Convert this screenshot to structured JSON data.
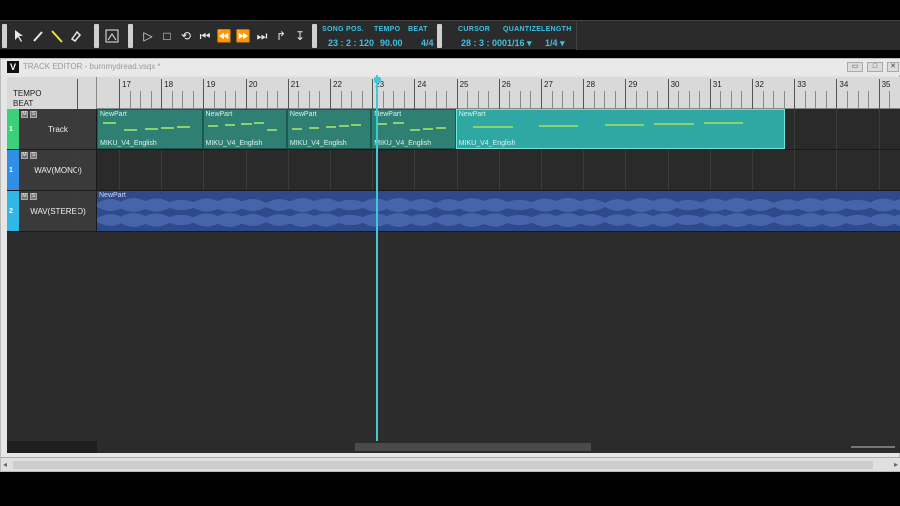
{
  "toolbar": {
    "tools": [
      {
        "name": "arrow-tool-icon"
      },
      {
        "name": "pencil-tool-icon"
      },
      {
        "name": "line-tool-icon",
        "active": true
      },
      {
        "name": "eraser-tool-icon"
      },
      {
        "name": "realtime-input-icon"
      }
    ],
    "transport": [
      {
        "name": "play-button",
        "glyph": "▷"
      },
      {
        "name": "stop-button",
        "glyph": "□"
      },
      {
        "name": "loop-button",
        "glyph": "⟲"
      },
      {
        "name": "go-to-start-button",
        "glyph": "⏮"
      },
      {
        "name": "rewind-button",
        "glyph": "⏪"
      },
      {
        "name": "fast-forward-button",
        "glyph": "⏩"
      },
      {
        "name": "go-to-end-button",
        "glyph": "⏭"
      },
      {
        "name": "auto-scroll-button",
        "glyph": "↱"
      },
      {
        "name": "punch-button",
        "glyph": "↧"
      }
    ],
    "song_pos_label": "SONG POS.",
    "song_pos_value": "23 : 2 : 120",
    "tempo_label": "TEMPO",
    "tempo_value": "90.00",
    "beat_label": "BEAT",
    "beat_value": "4/4",
    "cursor_label": "CURSOR",
    "cursor_value": "28 : 3 : 000",
    "quantize_label": "QUANTIZE",
    "quantize_value": "1/16 ▾",
    "length_label": "LENGTH",
    "length_value": "1/4 ▾"
  },
  "window": {
    "title": "TRACK EDITOR - burnmydread.vsqx *",
    "app_icon": "V",
    "minimize": "▭",
    "maximize": "□",
    "close": "✕"
  },
  "ruler": {
    "tempo_label": "TEMPO",
    "beat_label": "BEAT",
    "measures": [
      "17",
      "18",
      "19",
      "20",
      "21",
      "22",
      "23",
      "24",
      "25",
      "26",
      "27",
      "28",
      "29",
      "30",
      "31",
      "32",
      "33",
      "34",
      "35"
    ]
  },
  "tracks": [
    {
      "number": "1",
      "name": "Track",
      "color": "#3ad17a",
      "parts": [
        {
          "name": "NewPart",
          "voice": "MIKU_V4_English",
          "start": 17,
          "end": 19.5
        },
        {
          "name": "NewPart",
          "voice": "MIKU_V4_English",
          "start": 19.5,
          "end": 21.5
        },
        {
          "name": "NewPart",
          "voice": "MIKU_V4_English",
          "start": 21.5,
          "end": 23.5
        },
        {
          "name": "NewPart",
          "voice": "MIKU_V4_English",
          "start": 23.5,
          "end": 25.5
        },
        {
          "name": "NewPart",
          "voice": "MIKU_V4_English",
          "start": 25.5,
          "end": 33.3,
          "selected": true
        }
      ]
    },
    {
      "number": "1",
      "name": "WAV(MONO)",
      "color": "#2f8fe6"
    },
    {
      "number": "2",
      "name": "WAV(STEREO)",
      "color": "#2fb8e6",
      "wav_part": {
        "name": "NewPart",
        "start": 17,
        "end": 36
      }
    }
  ],
  "playhead_measure": 23.6
}
